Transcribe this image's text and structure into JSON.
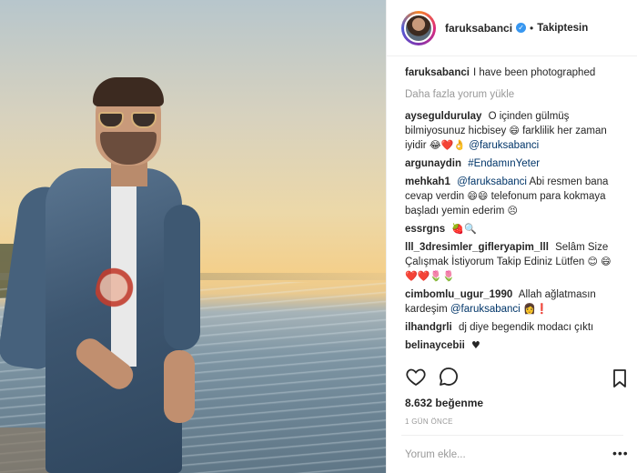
{
  "post": {
    "username": "faruksabanci",
    "follow_label": "Takiptesin",
    "caption": "I have been photographed",
    "load_more": "Daha fazla yorum yükle",
    "likes": "8.632 beğenme",
    "time": "1 GÜN ÖNCE",
    "comment_placeholder": "Yorum ekle..."
  },
  "comments": [
    {
      "user": "aysegulduruIay",
      "text_a": "O içinden gülmüş bilmiyosunuz hicbisey",
      "emoji_a": "😄",
      "text_b": "farklilik her zaman iyidir",
      "emoji_b": "😂❤️👌",
      "mention": "@faruksabanci"
    },
    {
      "user": "argunaydin",
      "text": "#EndamınYeter"
    },
    {
      "user": "mehkah1",
      "mention": "@faruksabanci",
      "text_a": "Abi resmen bana cevap verdin",
      "emoji_a": "😄😄",
      "text_b": "telefonum para kokmaya başladı yemin ederim",
      "emoji_b": "😣"
    },
    {
      "user": "essrgns",
      "emoji": "🍓🔍"
    },
    {
      "user": "lll_3dresimler_gifleryapim_lll",
      "text": "Selâm Size Çalışmak İstiyorum Takip Ediniz Lütfen",
      "emoji_a": "😊",
      "emoji_b": "😄❤️❤️🌷🌷"
    },
    {
      "user": "cimbomlu_ugur_1990",
      "text": "Allah ağlatmasın kardeşim",
      "mention": "@faruksabanci",
      "emoji": "👩❗"
    },
    {
      "user": "ilhandgrli",
      "text": "dj diye begendik modacı çıktı"
    },
    {
      "user": "belinaycebii",
      "emoji": "♥"
    }
  ],
  "icons": {
    "like": "heart-icon",
    "comment": "comment-icon",
    "save": "bookmark-icon",
    "verified": "verified-badge-icon"
  },
  "colors": {
    "link": "#003569",
    "muted": "#999999",
    "verified": "#3897f0",
    "text": "#262626"
  }
}
